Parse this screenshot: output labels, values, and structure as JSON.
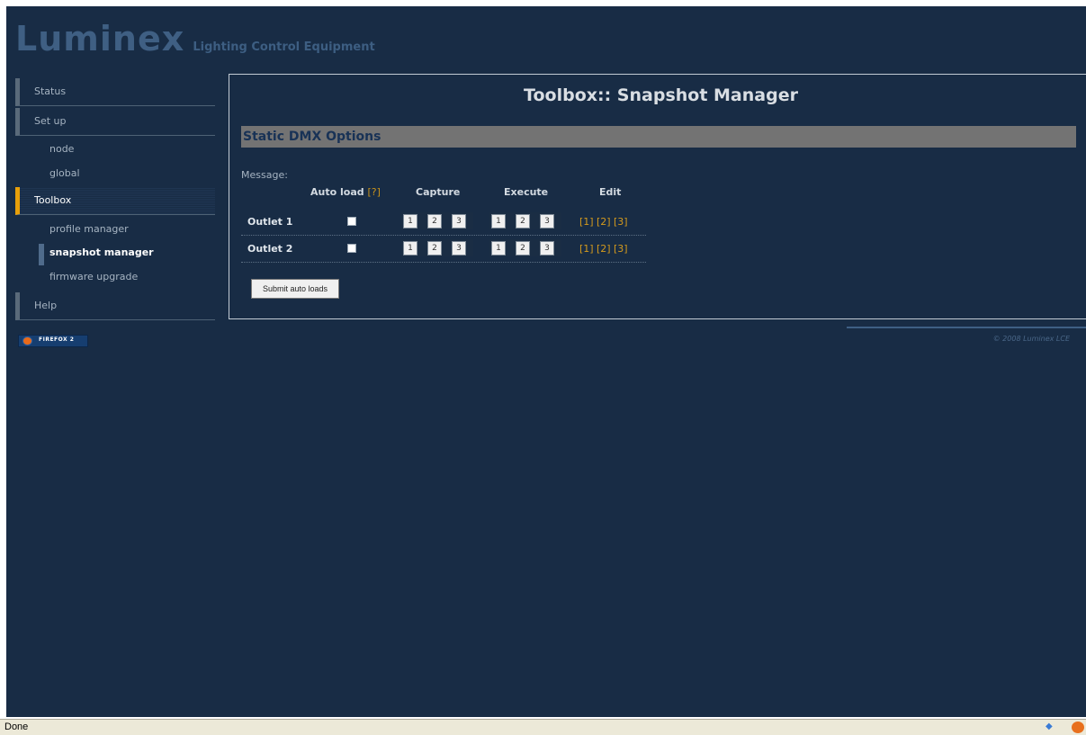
{
  "logo": {
    "word": "Luminex",
    "tagline": "Lighting Control Equipment"
  },
  "nav": {
    "status": "Status",
    "setup": "Set up",
    "setup_items": [
      "node",
      "global"
    ],
    "toolbox": "Toolbox",
    "toolbox_items": [
      "profile manager",
      "snapshot manager",
      "firmware upgrade"
    ],
    "help": "Help"
  },
  "badge": {
    "label": "FIREFOX 2"
  },
  "content": {
    "title": "Toolbox:: Snapshot Manager",
    "section": "Static DMX Options",
    "message_label": "Message:",
    "headers": {
      "autoload": "Auto load",
      "autoload_help": "[?]",
      "capture": "Capture",
      "execute": "Execute",
      "edit": "Edit"
    },
    "outlets": [
      {
        "name": "Outlet 1",
        "autoload": false,
        "capture": [
          "1",
          "2",
          "3"
        ],
        "execute": [
          "1",
          "2",
          "3"
        ],
        "edit": [
          "[1]",
          "[2]",
          "[3]"
        ]
      },
      {
        "name": "Outlet 2",
        "autoload": false,
        "capture": [
          "1",
          "2",
          "3"
        ],
        "execute": [
          "1",
          "2",
          "3"
        ],
        "edit": [
          "[1]",
          "[2]",
          "[3]"
        ]
      }
    ],
    "submit": "Submit auto loads"
  },
  "footer": {
    "copyright": "© 2008 Luminex LCE"
  },
  "statusbar": {
    "text": "Done"
  },
  "colors": {
    "background": "#182c45",
    "accent": "#e8a00a",
    "section_bar": "#737373",
    "link": "#d49a1d"
  }
}
